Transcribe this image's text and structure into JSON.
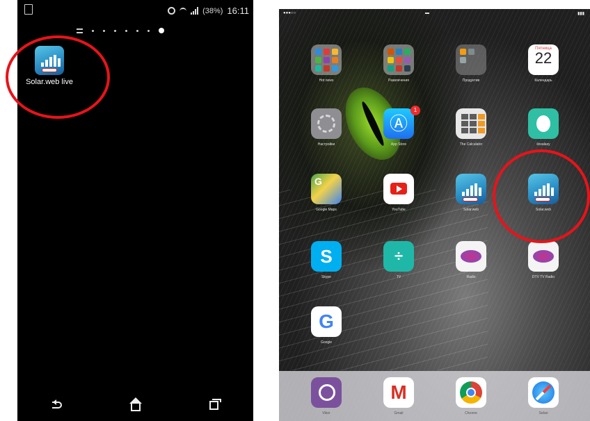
{
  "android": {
    "status": {
      "battery": "(38%)",
      "time": "16:11"
    },
    "app": {
      "label": "Solar.web live"
    }
  },
  "ipad": {
    "calendar": {
      "day": "Пятница",
      "date": "22"
    },
    "apps": [
      {
        "label": "Hot news"
      },
      {
        "label": "Развлечения"
      },
      {
        "label": "Продуктив"
      },
      {
        "label": "Календарь"
      },
      {
        "label": "Настройки"
      },
      {
        "label": "App Store"
      },
      {
        "label": "The Calculator"
      },
      {
        "label": "ilovalaxy"
      },
      {
        "label": "Google Maps"
      },
      {
        "label": "YouTube"
      },
      {
        "label": "Solar.web"
      },
      {
        "label": "Solar.web"
      },
      {
        "label": "Skype"
      },
      {
        "label": "TV"
      },
      {
        "label": "Radio"
      },
      {
        "label": "DTV TV Radio"
      },
      {
        "label": "Google"
      }
    ],
    "app_store_badge": "1",
    "dock": [
      {
        "label": "Viber"
      },
      {
        "label": "Gmail"
      },
      {
        "label": "Chrome"
      },
      {
        "label": "Safari"
      }
    ]
  },
  "colors": {
    "annotation": "#e8131a",
    "solar_icon": "#2b8fc6"
  }
}
